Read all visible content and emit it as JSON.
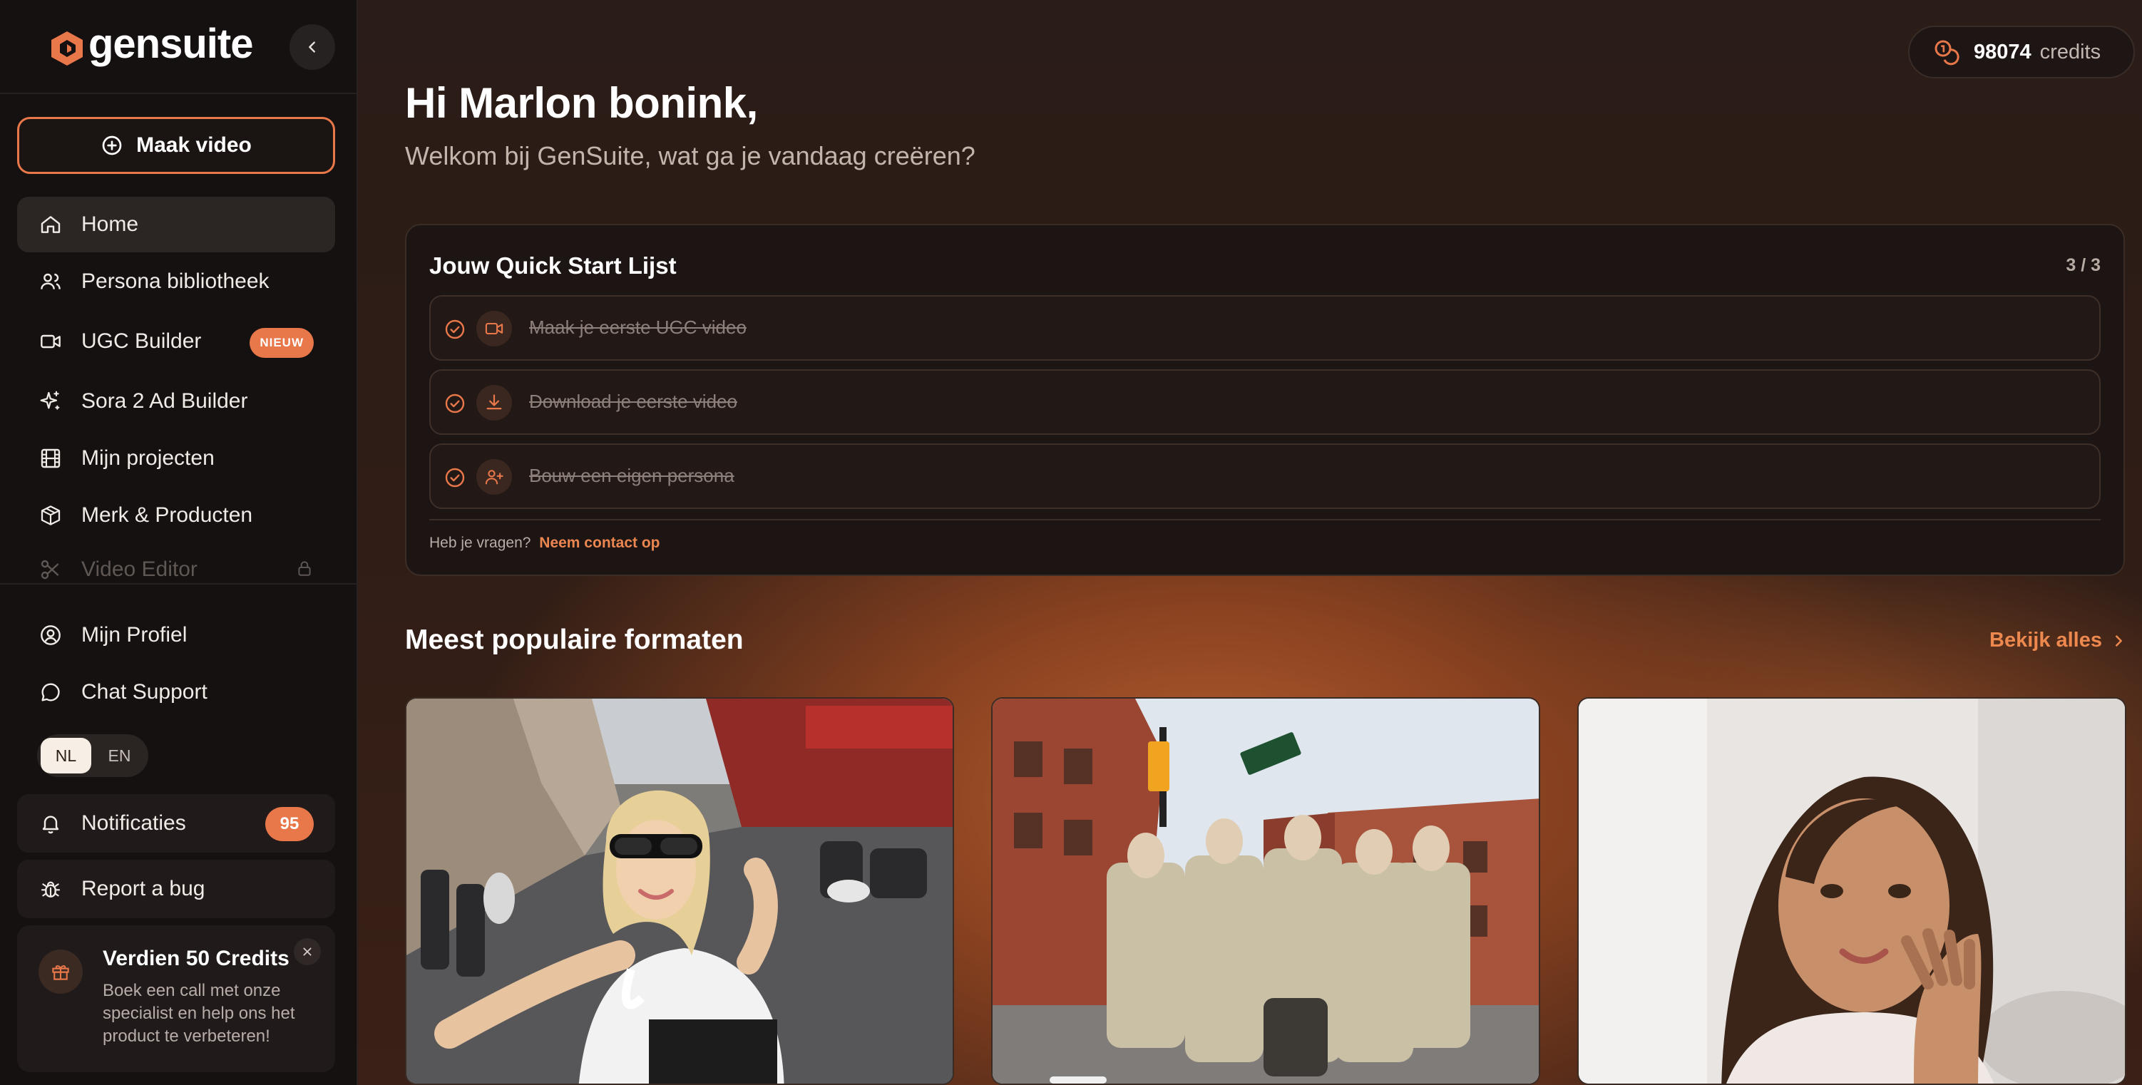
{
  "app": {
    "brand": "gensuite"
  },
  "sidebar": {
    "make_video": "Maak video",
    "nav": [
      {
        "label": "Home",
        "icon": "home-icon",
        "active": true
      },
      {
        "label": "Persona bibliotheek",
        "icon": "users-icon"
      },
      {
        "label": "UGC Builder",
        "icon": "video-icon",
        "badge": "NIEUW"
      },
      {
        "label": "Sora 2 Ad Builder",
        "icon": "sparkles-icon"
      },
      {
        "label": "Mijn projecten",
        "icon": "film-icon"
      },
      {
        "label": "Merk & Producten",
        "icon": "box-icon"
      },
      {
        "label": "Video Editor",
        "icon": "scissors-icon",
        "locked": true
      }
    ],
    "profile": "Mijn Profiel",
    "chat_support": "Chat Support",
    "languages": [
      "NL",
      "EN"
    ],
    "language_selected": "NL",
    "notifications": {
      "label": "Notificaties",
      "count": "95"
    },
    "report_bug": "Report a bug",
    "promo": {
      "title": "Verdien 50 Credits",
      "body": "Boek een call met onze specialist en help ons het product te verbeteren!"
    }
  },
  "header": {
    "credits_value": "98074",
    "credits_label": "credits"
  },
  "main": {
    "greeting": "Hi Marlon bonink,",
    "subtitle": "Welkom bij GenSuite, wat ga je vandaag creëren?",
    "quick_start": {
      "title": "Jouw Quick Start Lijst",
      "progress": "3 / 3",
      "tasks": [
        {
          "label": "Maak je eerste UGC video",
          "icon": "video-icon",
          "done": true
        },
        {
          "label": "Download je eerste video",
          "icon": "download-icon",
          "done": true
        },
        {
          "label": "Bouw een eigen persona",
          "icon": "user-plus-icon",
          "done": true
        }
      ],
      "footer_text": "Heb je vragen?",
      "footer_link": "Neem contact op"
    },
    "popular": {
      "title": "Meest populaire formaten",
      "see_all": "Bekijk alles",
      "items": [
        {
          "name": "selfie-street-thumbnail"
        },
        {
          "name": "group-street-thumbnail"
        },
        {
          "name": "beauty-testimonial-thumbnail"
        }
      ]
    }
  },
  "colors": {
    "accent": "#e8774a",
    "sidebar_bg": "#141110"
  }
}
